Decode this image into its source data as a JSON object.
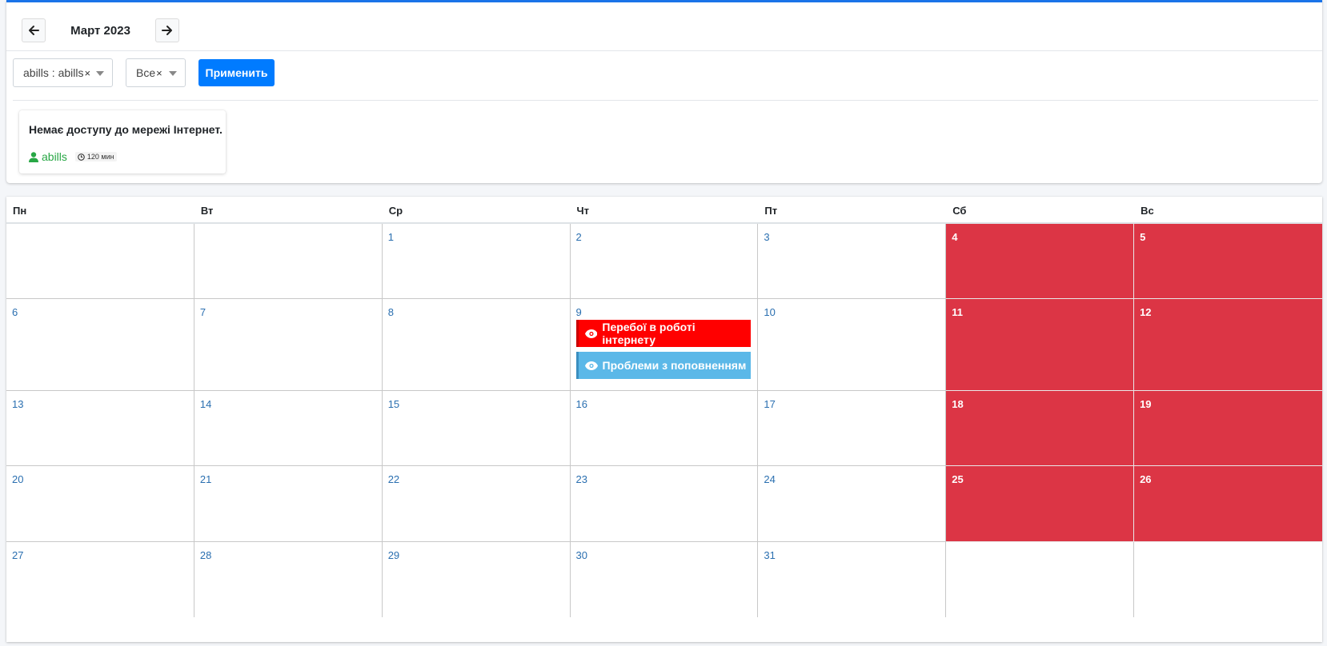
{
  "header": {
    "month_title": "Март 2023",
    "prev_icon": "arrow-left-icon",
    "next_icon": "arrow-right-icon",
    "accent_color": "#1a73e8"
  },
  "filters": {
    "select1_value": "abills : abills",
    "select2_value": "Все",
    "clear_symbol": "×",
    "apply_label": "Применить"
  },
  "notice": {
    "title": "Немає доступу до мережі Інтернет.",
    "user": "abills",
    "duration": "120 мин"
  },
  "calendar": {
    "weekdays": [
      "Пн",
      "Вт",
      "Ср",
      "Чт",
      "Пт",
      "Сб",
      "Вс"
    ],
    "weeks": [
      [
        "",
        "",
        "1",
        "2",
        "3",
        "4",
        "5"
      ],
      [
        "6",
        "7",
        "8",
        "9",
        "10",
        "11",
        "12"
      ],
      [
        "13",
        "14",
        "15",
        "16",
        "17",
        "18",
        "19"
      ],
      [
        "20",
        "21",
        "22",
        "23",
        "24",
        "25",
        "26"
      ],
      [
        "27",
        "28",
        "29",
        "30",
        "31",
        "",
        ""
      ]
    ],
    "events": [
      {
        "label": "Перебої в роботі інтернету",
        "color": "#ff0000"
      },
      {
        "label": "Проблеми з поповненням",
        "color": "#5bb8e8"
      }
    ],
    "weekend_color": "#dc3545"
  }
}
